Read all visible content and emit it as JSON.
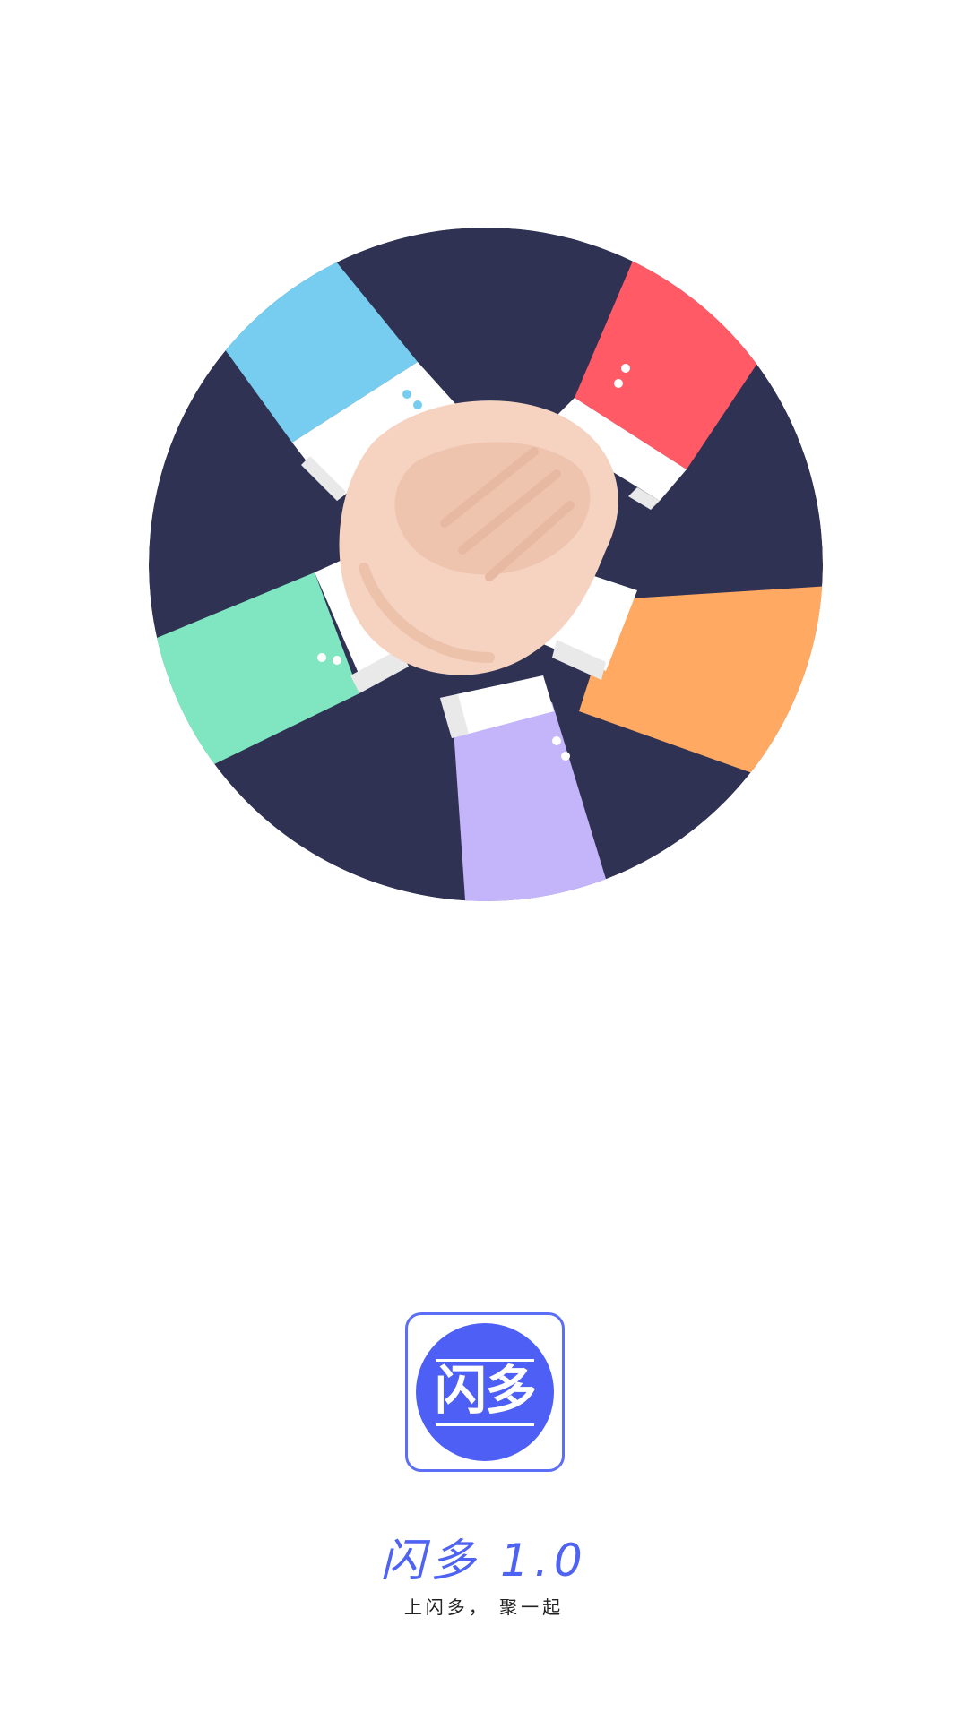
{
  "splash": {
    "illustration_icon": "team-hands-illustration",
    "app_icon": "app-logo-icon",
    "app_icon_text": "闪多",
    "title": "闪多 1.0",
    "slogan": "上闪多， 聚一起"
  },
  "colors": {
    "background": "#ffffff",
    "illustration_background": "#2f3252",
    "accent": "#4d5ff5",
    "sleeve_blue": "#76cdf0",
    "sleeve_red": "#ff5a66",
    "sleeve_green": "#7fe6c1",
    "sleeve_orange": "#ffa962",
    "sleeve_purple": "#c4b5fb",
    "skin": "#f6d2c0",
    "cuff": "#ffffff"
  }
}
